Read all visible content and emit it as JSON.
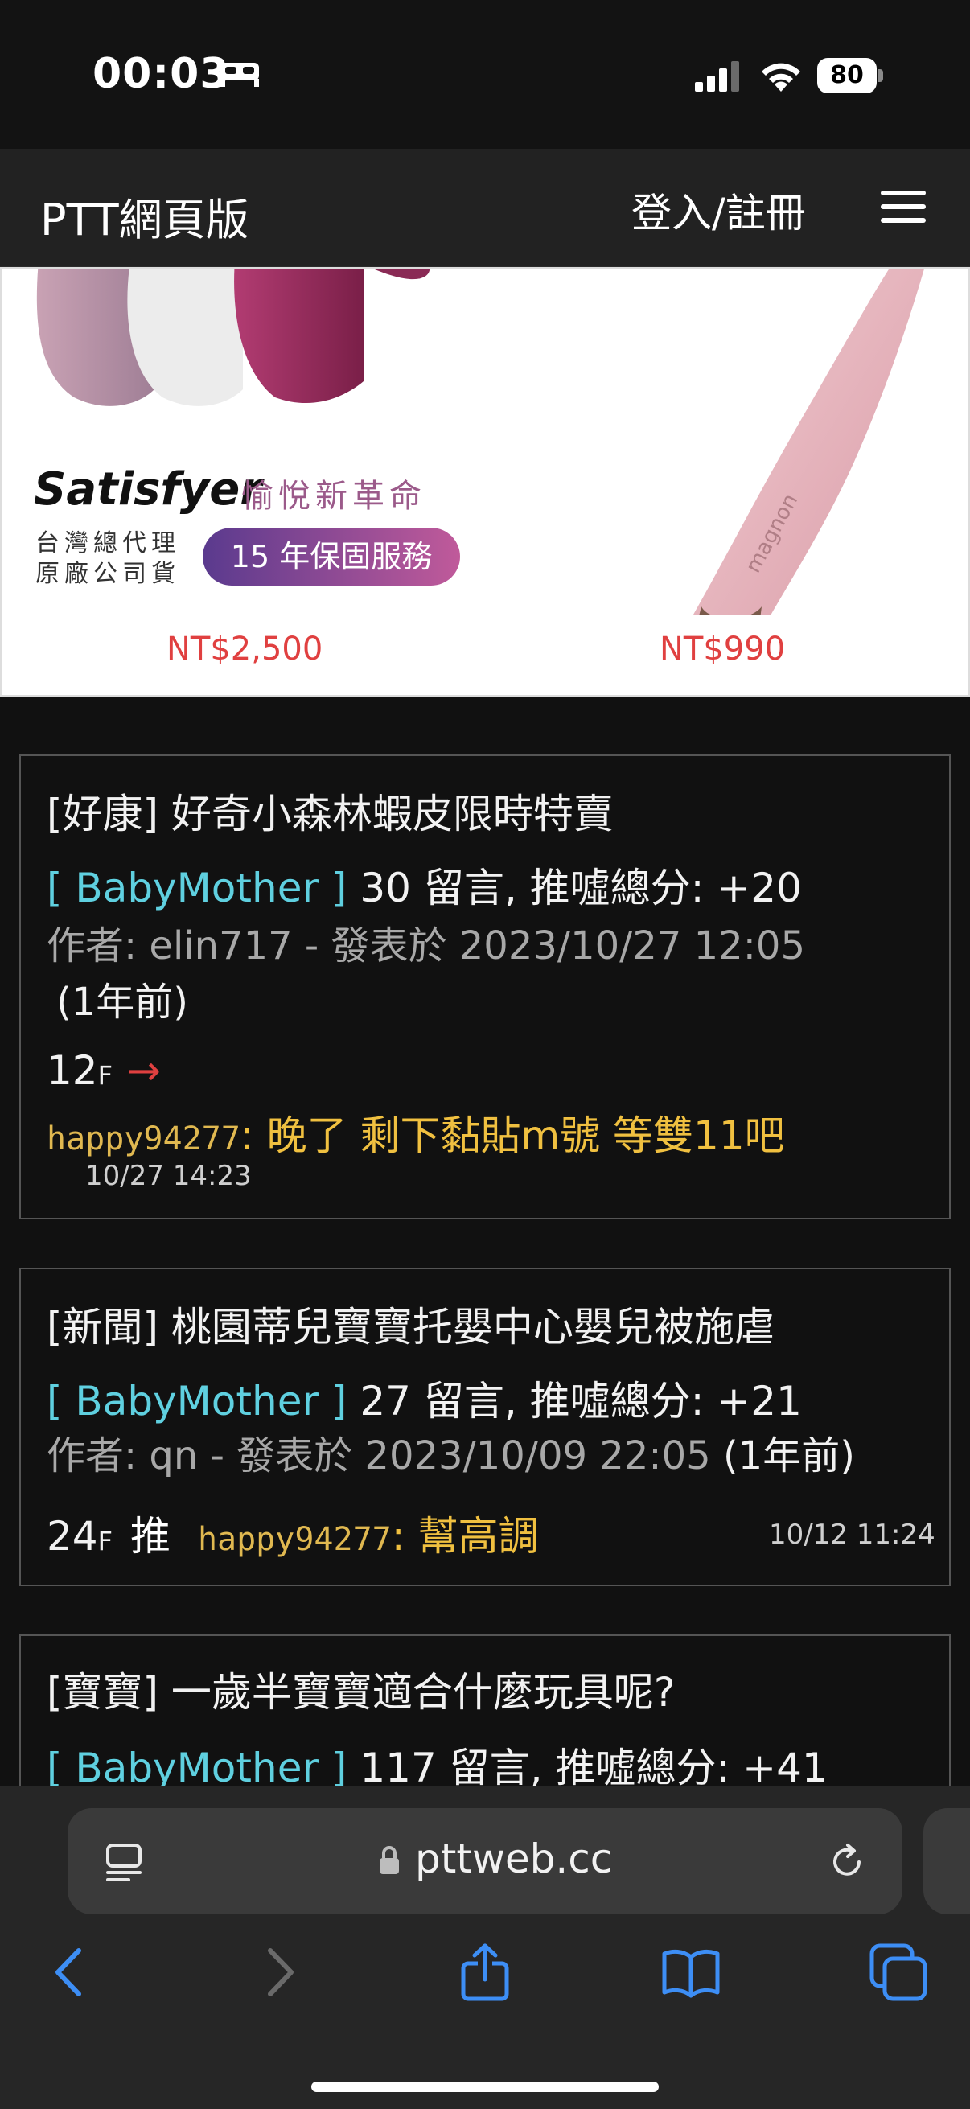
{
  "status_bar": {
    "time": "00:03",
    "battery": "80",
    "icons": [
      "sleep-focus-icon",
      "cellular-signal-icon",
      "wifi-icon",
      "battery-icon"
    ]
  },
  "header": {
    "brand": "PTT網頁版",
    "login": "登入/註冊",
    "menu_icon": "hamburger-menu-icon"
  },
  "ad": {
    "brand": "Satisfyer",
    "slogan": "愉悅新革命",
    "sub_line1": "台灣總代理",
    "sub_line2": "原廠公司貨",
    "badge": "15 年保固服務",
    "price_left": "NT$2,500",
    "price_right": "NT$990",
    "product_tag": "magnon"
  },
  "posts": [
    {
      "title": "[好康] 好奇小森林蝦皮限時特賣",
      "board": "[ BabyMother ]",
      "comments": "30 留言, 推噓總分: +20",
      "author_line": "作者: elin717 - 發表於 2023/10/27 12:05",
      "ago": "(1年前)",
      "floor": "12",
      "floor_suffix": "F",
      "push": "→",
      "commenter": "happy94277",
      "comment": ": 晚了 剩下黏貼m號 等雙11吧",
      "comment_time": "10/27 14:23"
    },
    {
      "title": "[新聞] 桃園蒂兒寶寶托嬰中心嬰兒被施虐",
      "board": "[ BabyMother ]",
      "comments": "27 留言, 推噓總分: +21",
      "author_line": "作者: qn - 發表於 2023/10/09 22:05",
      "ago": "(1年前)",
      "floor": "24",
      "floor_suffix": "F",
      "push": "推",
      "commenter": "happy94277",
      "comment": ": 幫高調",
      "comment_time": "10/12 11:24"
    },
    {
      "title": "[寶寶] 一歲半寶寶適合什麼玩具呢?",
      "board": "[ BabyMother ]",
      "comments": "117 留言, 推噓總分: +41"
    }
  ],
  "browser": {
    "url": "pttweb.cc",
    "icons": [
      "reader-mode-icon",
      "lock-icon",
      "reload-icon",
      "back-icon",
      "forward-icon",
      "share-icon",
      "bookmarks-icon",
      "tabs-icon"
    ]
  },
  "colors": {
    "board": "#5fd0e0",
    "commenter": "#e0b850",
    "comment": "#f0c040",
    "price": "#e04040",
    "arrow": "#e04040",
    "toolbar_icon": "#3d8ef5"
  }
}
